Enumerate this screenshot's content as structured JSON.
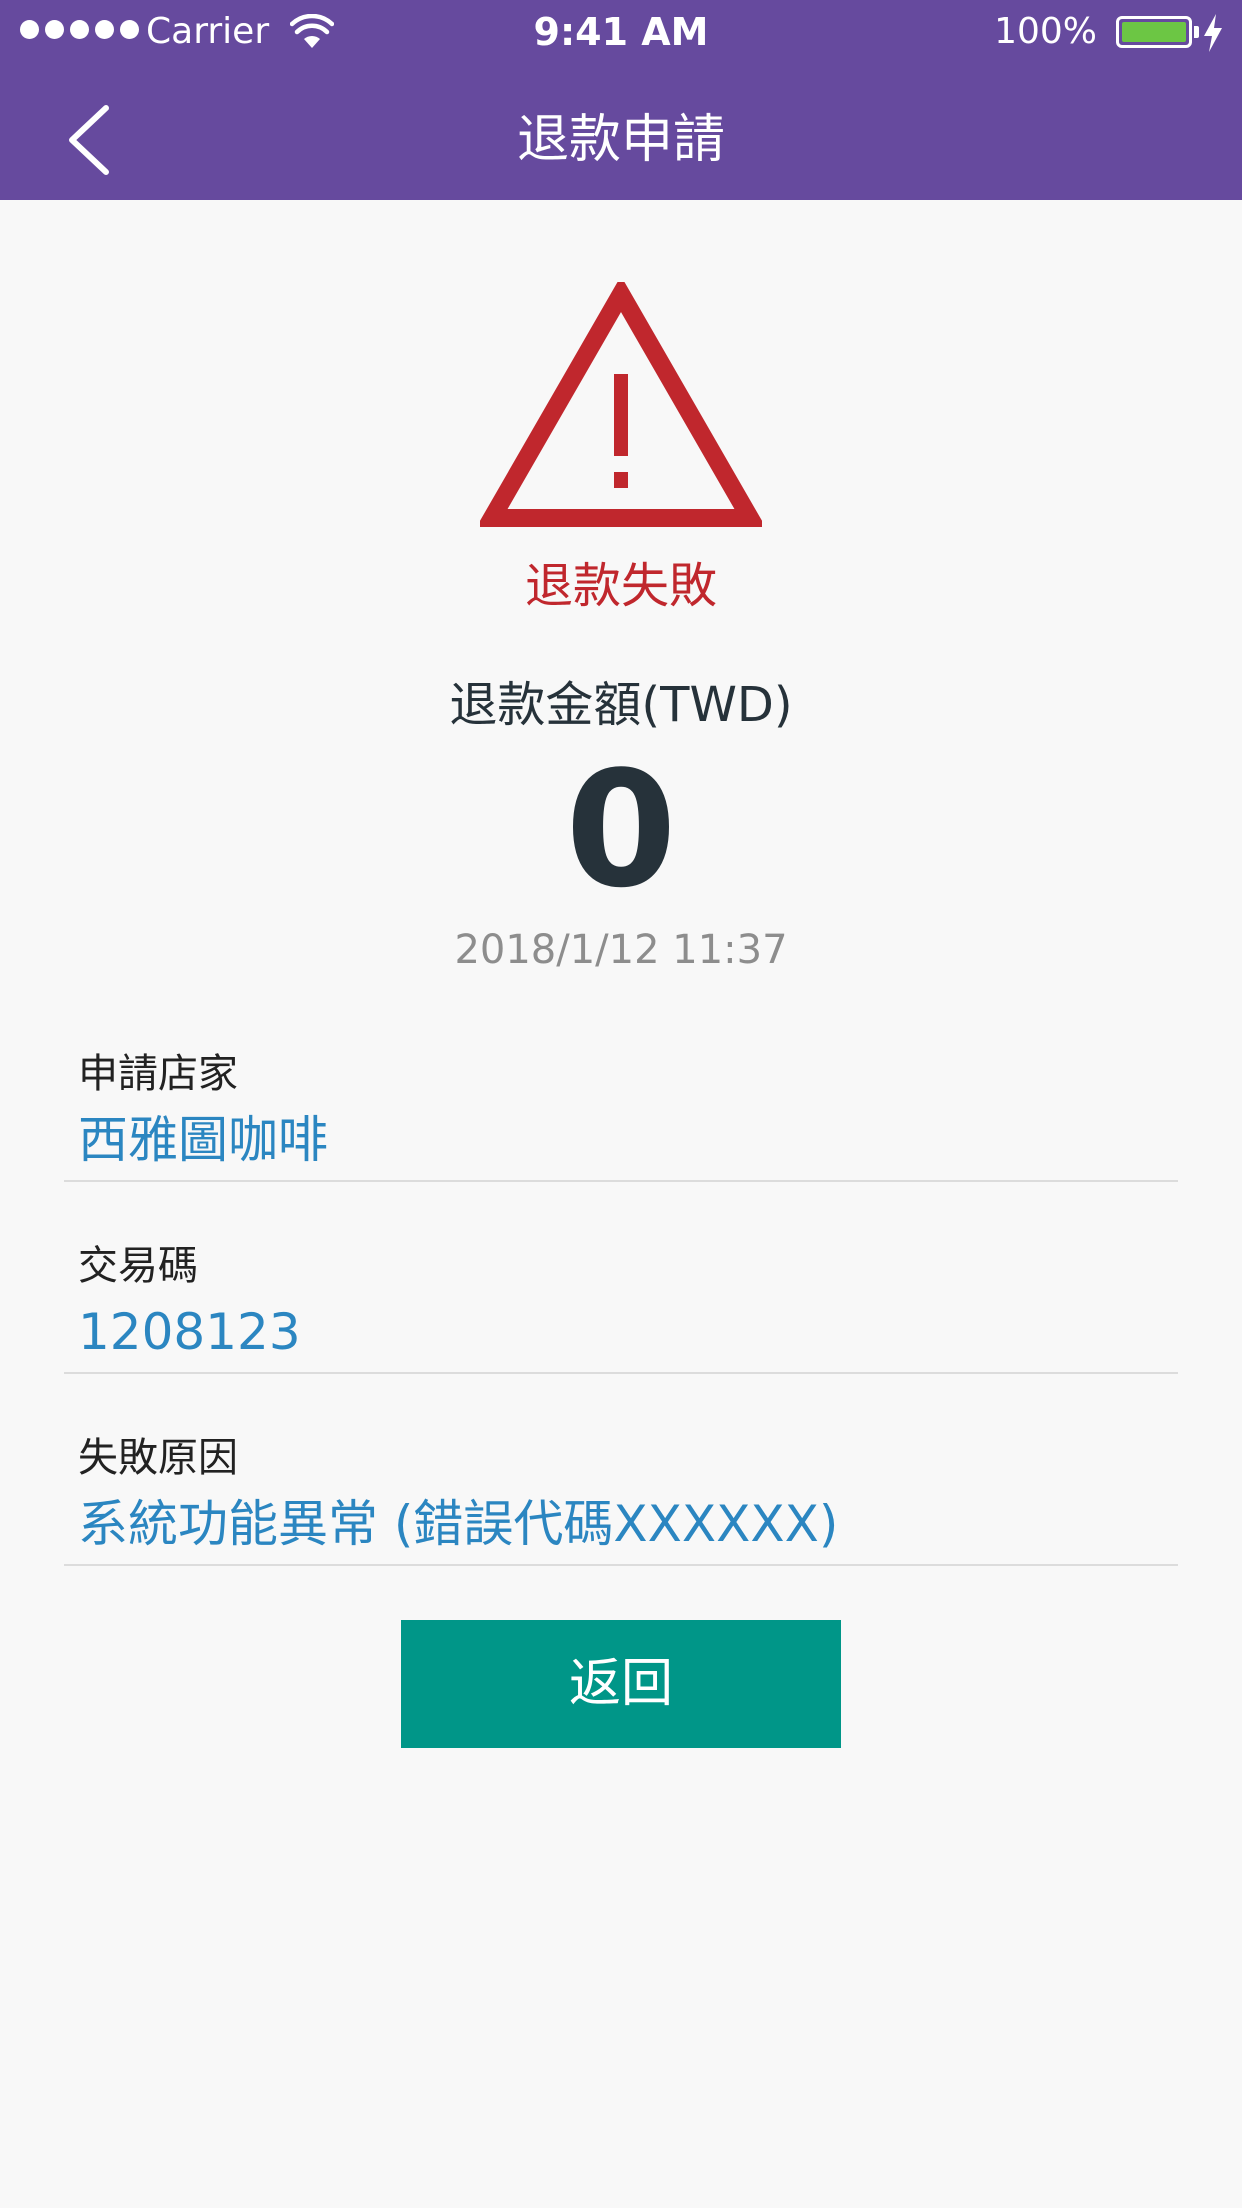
{
  "status_bar": {
    "carrier": "Carrier",
    "time": "9:41 AM",
    "battery_percent": "100%"
  },
  "header": {
    "title": "退款申請",
    "back_icon": "chevron-left-icon",
    "background_color": "#664a9e"
  },
  "result": {
    "icon": "warning-triangle-icon",
    "status_text": "退款失敗",
    "status_color": "#c0272d",
    "amount_label": "退款金額(TWD)",
    "amount": "0",
    "timestamp": "2018/1/12 11:37"
  },
  "details": [
    {
      "label": "申請店家",
      "value": "西雅圖咖啡"
    },
    {
      "label": "交易碼",
      "value": "1208123"
    },
    {
      "label": "失敗原因",
      "value": "系統功能異常 (錯誤代碼XXXXXX)"
    }
  ],
  "actions": {
    "return_label": "返回",
    "button_color": "#009688"
  }
}
